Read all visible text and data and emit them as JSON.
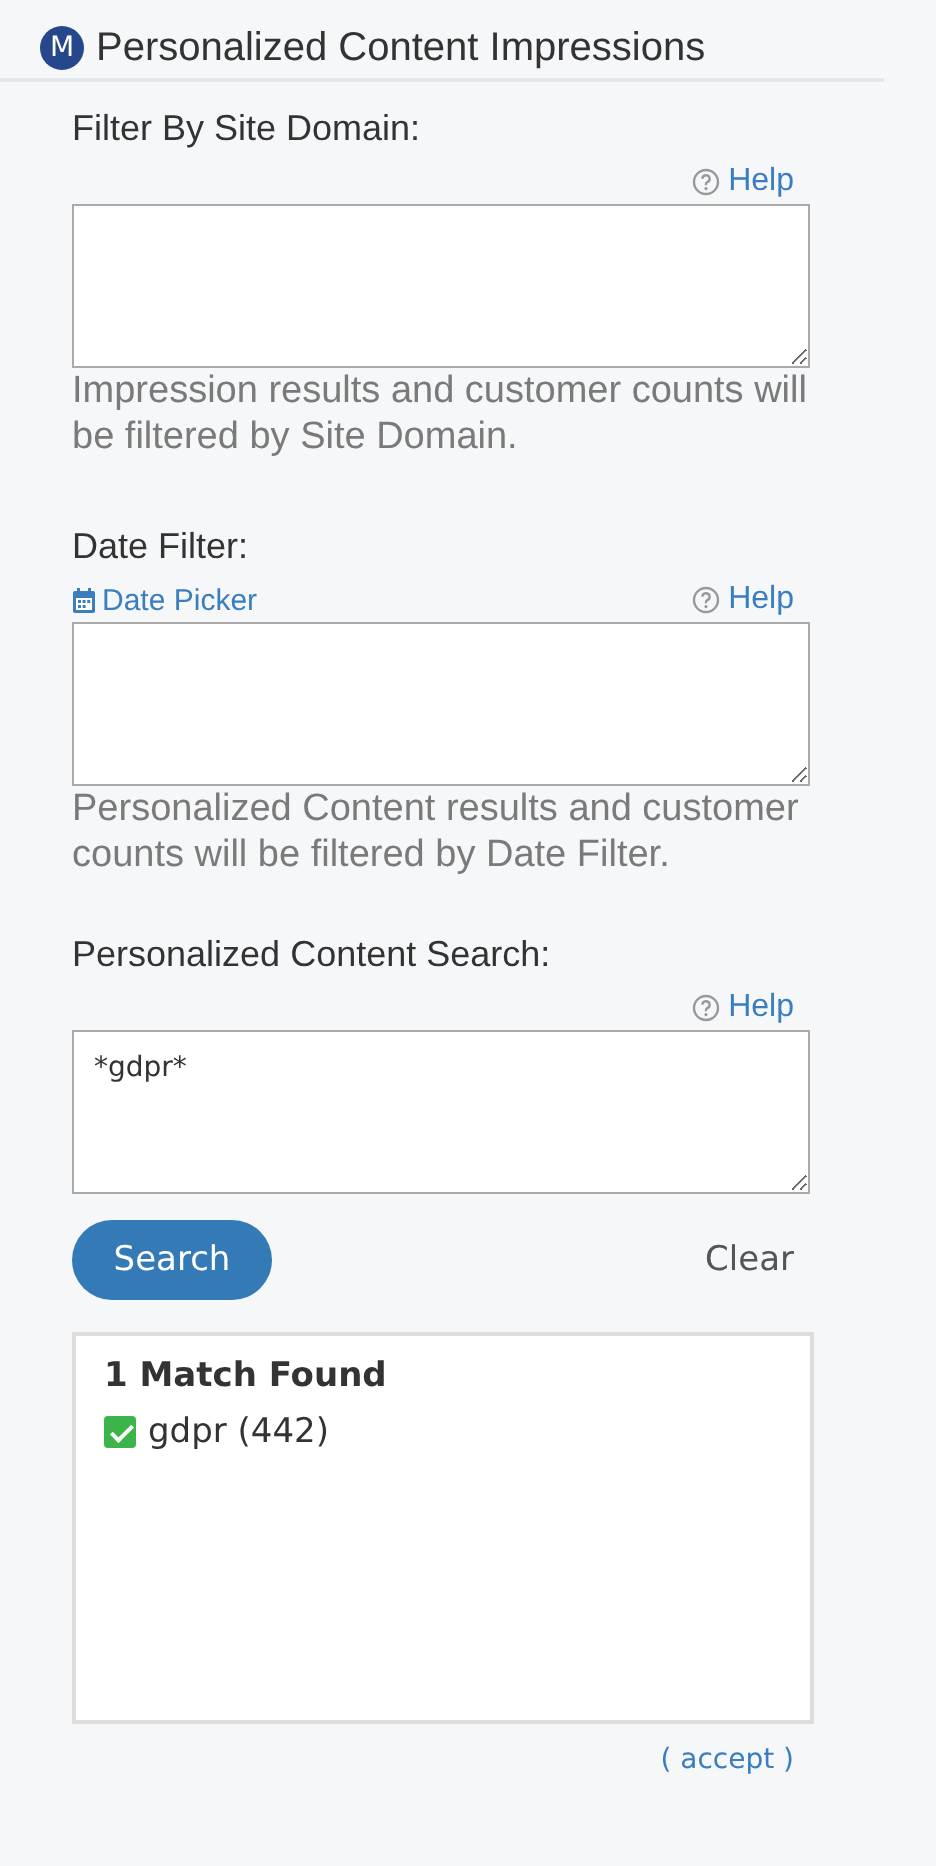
{
  "header": {
    "badge": "M",
    "title": "Personalized Content Impressions"
  },
  "sections": [
    {
      "label": "Filter By Site Domain:",
      "help": "Help",
      "hint": "Impression results and customer counts will be filtered by Site Domain."
    },
    {
      "label": "Date Filter:",
      "date_picker": "Date Picker",
      "help": "Help",
      "hint": "Personalized Content results and customer counts will be filtered by Date Filter."
    },
    {
      "label": "Personalized Content Search:",
      "help": "Help",
      "value": "*gdpr*"
    }
  ],
  "buttons": {
    "search": "Search",
    "clear": "Clear"
  },
  "results": {
    "heading": "1 Match Found",
    "items": [
      {
        "label": "gdpr (442)",
        "checked": true
      }
    ]
  },
  "accept_link": "( accept )"
}
